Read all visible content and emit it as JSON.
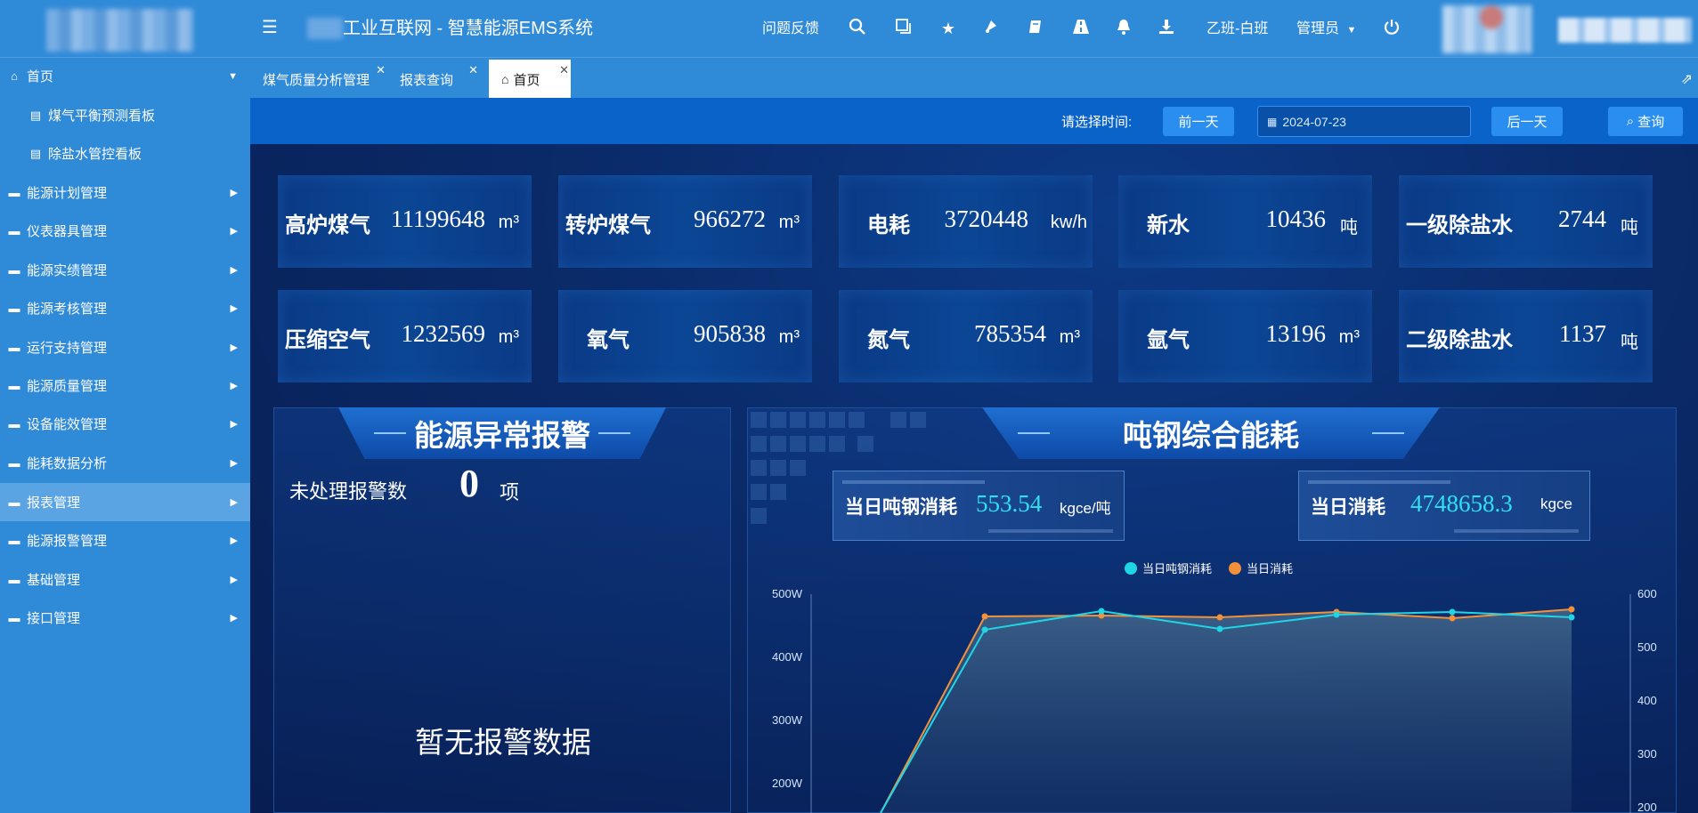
{
  "header": {
    "title": "工业互联网 - 智慧能源EMS系统",
    "feedback": "问题反馈",
    "shift": "乙班-白班",
    "admin": "管理员"
  },
  "sidebar": {
    "items": [
      {
        "label": "首页",
        "type": "group-open"
      },
      {
        "label": "煤气平衡预测看板",
        "type": "sub"
      },
      {
        "label": "除盐水管控看板",
        "type": "sub"
      },
      {
        "label": "能源计划管理",
        "type": "group"
      },
      {
        "label": "仪表器具管理",
        "type": "group"
      },
      {
        "label": "能源实绩管理",
        "type": "group"
      },
      {
        "label": "能源考核管理",
        "type": "group"
      },
      {
        "label": "运行支持管理",
        "type": "group"
      },
      {
        "label": "能源质量管理",
        "type": "group"
      },
      {
        "label": "设备能效管理",
        "type": "group"
      },
      {
        "label": "能耗数据分析",
        "type": "group"
      },
      {
        "label": "报表管理",
        "type": "group-active"
      },
      {
        "label": "能源报警管理",
        "type": "group"
      },
      {
        "label": "基础管理",
        "type": "group"
      },
      {
        "label": "接口管理",
        "type": "group"
      }
    ]
  },
  "tabs": [
    {
      "label": "煤气质量分析管理"
    },
    {
      "label": "报表查询"
    },
    {
      "label": "首页"
    }
  ],
  "query": {
    "label": "请选择时间:",
    "prev": "前一天",
    "date": "2024-07-23",
    "next": "后一天",
    "search": "查询"
  },
  "cards": [
    {
      "name": "高炉煤气",
      "value": "11199648",
      "unit": "m³"
    },
    {
      "name": "转炉煤气",
      "value": "966272",
      "unit": "m³"
    },
    {
      "name": "电耗",
      "value": "3720448",
      "unit": "kw/h"
    },
    {
      "name": "新水",
      "value": "10436",
      "unit": "吨"
    },
    {
      "name": "一级除盐水",
      "value": "2744",
      "unit": "吨"
    },
    {
      "name": "压缩空气",
      "value": "1232569",
      "unit": "m³"
    },
    {
      "name": "氧气",
      "value": "905838",
      "unit": "m³"
    },
    {
      "name": "氮气",
      "value": "785354",
      "unit": "m³"
    },
    {
      "name": "氩气",
      "value": "13196",
      "unit": "m³"
    },
    {
      "name": "二级除盐水",
      "value": "1137",
      "unit": "吨"
    }
  ],
  "alarm": {
    "title": "能源异常报警",
    "unhandled_label": "未处理报警数",
    "count": "0",
    "unit": "项",
    "empty": "暂无报警数据"
  },
  "energy": {
    "title": "吨钢综合能耗",
    "daily_steel_label": "当日吨钢消耗",
    "daily_steel_value": "553.54",
    "daily_steel_unit": "kgce/吨",
    "daily_total_label": "当日消耗",
    "daily_total_value": "4748658.3",
    "daily_total_unit": "kgce"
  },
  "chart_data": {
    "type": "line",
    "series": [
      {
        "name": "当日吨钢消耗",
        "color": "#1ed6e6",
        "axis": "right",
        "values": [
          null,
          520,
          545,
          520,
          540,
          543,
          538
        ]
      },
      {
        "name": "当日消耗",
        "color": "#f3913a",
        "axis": "left",
        "values": [
          null,
          455,
          456,
          455,
          465,
          456,
          470
        ]
      }
    ],
    "y_left": {
      "ticks": [
        "500W",
        "400W",
        "300W",
        "200W"
      ]
    },
    "y_right": {
      "ticks": [
        "600",
        "500",
        "400",
        "300",
        "200"
      ]
    }
  },
  "colors": {
    "brand": "#2f8ad8",
    "accent": "#2a8ef0",
    "cyan": "#1ed6e6",
    "orange": "#f3913a"
  }
}
